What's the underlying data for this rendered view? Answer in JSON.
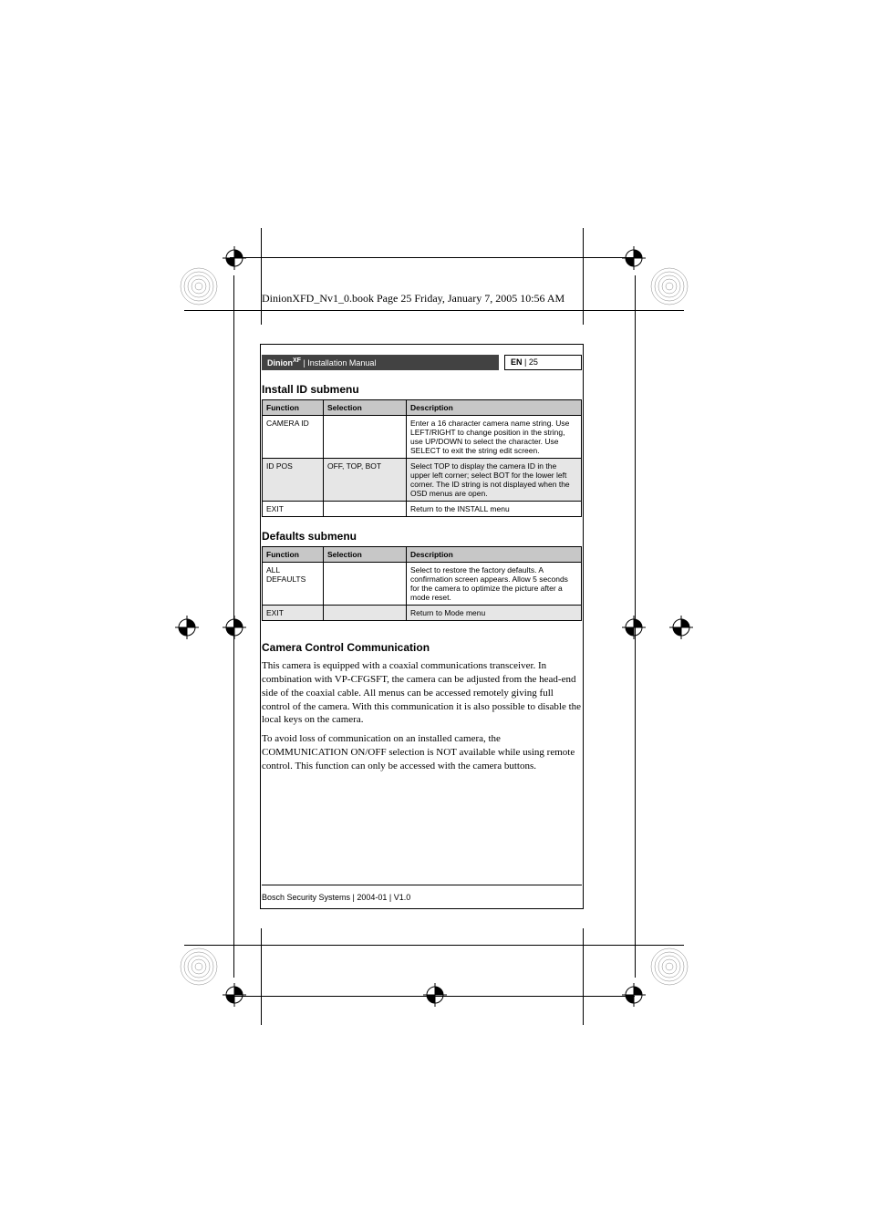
{
  "proof_header": "DinionXFD_Nv1_0.book  Page 25  Friday, January 7, 2005  10:56 AM",
  "header": {
    "brand": "Dinion",
    "brand_sup": "XF",
    "divider": " | ",
    "manual": "Installation Manual",
    "lang": "EN",
    "page_sep": " | ",
    "page_num": "25"
  },
  "sections": {
    "install_id": {
      "title": "Install ID submenu",
      "columns": {
        "function": "Function",
        "selection": "Selection",
        "description": "Description"
      },
      "rows": [
        {
          "function": "CAMERA ID",
          "selection": "",
          "description": "Enter a 16 character camera name string. Use LEFT/RIGHT to change position in the string, use UP/DOWN to select the character. Use SELECT to exit the string edit screen."
        },
        {
          "function": "ID POS",
          "selection": "OFF, TOP, BOT",
          "description": "Select TOP to display the camera ID in the upper left corner; select BOT for the lower left corner. The ID string is not displayed when the OSD menus are open."
        },
        {
          "function": "EXIT",
          "selection": "",
          "description": "Return to the INSTALL menu"
        }
      ]
    },
    "defaults": {
      "title": "Defaults submenu",
      "columns": {
        "function": "Function",
        "selection": "Selection",
        "description": "Description"
      },
      "rows": [
        {
          "function": "ALL DEFAULTS",
          "selection": "",
          "description": "Select to restore the factory defaults. A confirmation screen appears. Allow 5 seconds for the camera to optimize the picture after a mode reset."
        },
        {
          "function": "EXIT",
          "selection": "",
          "description": "Return to Mode menu"
        }
      ]
    },
    "ccc": {
      "title": "Camera Control Communication",
      "paragraphs": [
        "This camera is equipped with a coaxial communications transceiver. In combination with VP-CFGSFT, the camera can be adjusted from the head-end side of the coaxial cable. All menus can be accessed remotely giving full control of the camera. With this communication it is also possible to disable the local keys on the camera.",
        "To avoid loss of communication on an installed camera, the COMMUNICATION ON/OFF selection is NOT available while using remote control. This function can only be accessed with the camera buttons."
      ]
    }
  },
  "footer": "Bosch Security Systems | 2004-01 | V1.0"
}
